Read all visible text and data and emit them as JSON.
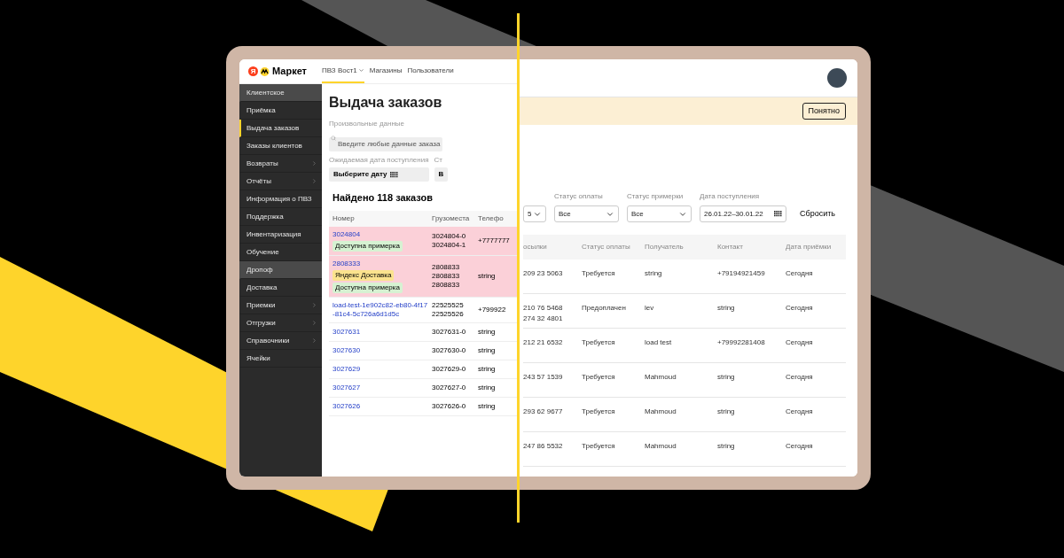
{
  "old_version": {
    "logo": {
      "mark": "Я",
      "text": "Маркет"
    },
    "nav_tabs": [
      {
        "label": "ПВЗ Вост1",
        "selected": true,
        "dropdown": true
      },
      {
        "label": "Магазины",
        "selected": false,
        "dropdown": false
      },
      {
        "label": "Пользователи",
        "selected": false,
        "dropdown": false
      }
    ],
    "sidebar": {
      "items": [
        {
          "label": "Клиентское",
          "selected": false,
          "highlighted": true,
          "expandable": false
        },
        {
          "label": "Приёмка",
          "selected": false,
          "highlighted": false,
          "expandable": false
        },
        {
          "label": "Выдача заказов",
          "selected": true,
          "highlighted": false,
          "expandable": false
        },
        {
          "label": "Заказы клиентов",
          "selected": false,
          "highlighted": false,
          "expandable": false
        },
        {
          "label": "Возвраты",
          "selected": false,
          "highlighted": false,
          "expandable": true
        },
        {
          "label": "Отчёты",
          "selected": false,
          "highlighted": false,
          "expandable": true
        },
        {
          "label": "Информация о ПВЗ",
          "selected": false,
          "highlighted": false,
          "expandable": false
        },
        {
          "label": "Поддержка",
          "selected": false,
          "highlighted": false,
          "expandable": false
        },
        {
          "label": "Инвентаризация",
          "selected": false,
          "highlighted": false,
          "expandable": false
        },
        {
          "label": "Обучение",
          "selected": false,
          "highlighted": false,
          "expandable": false
        },
        {
          "label": "Дропоф",
          "selected": false,
          "highlighted": true,
          "expandable": false
        },
        {
          "label": "Доставка",
          "selected": false,
          "highlighted": false,
          "expandable": false
        },
        {
          "label": "Приемки",
          "selected": false,
          "highlighted": false,
          "expandable": true
        },
        {
          "label": "Отгрузки",
          "selected": false,
          "highlighted": false,
          "expandable": true
        },
        {
          "label": "Справочники",
          "selected": false,
          "highlighted": false,
          "expandable": true
        },
        {
          "label": "Ячейки",
          "selected": false,
          "highlighted": false,
          "expandable": false
        }
      ]
    },
    "title": "Выдача заказов",
    "filters": [
      {
        "kind": "search",
        "label": "Произвольные данные",
        "placeholder": "Введите любые данные заказа"
      },
      {
        "kind": "date",
        "label": "Ожидаемая дата поступления",
        "value": "Выберите дату"
      },
      {
        "kind": "cut",
        "label": "Ст",
        "value": "В"
      }
    ],
    "found": "Найдено 118 заказов",
    "table": {
      "columns": [
        "Номер",
        "Грузоместа",
        "Телефо"
      ],
      "rows": [
        {
          "number": "3024804",
          "highlighted": true,
          "badges": [
            {
              "label": "Доступна примерка",
              "color": "#d6f2d2"
            }
          ],
          "places": [
            "3024804-0",
            "3024804-1"
          ],
          "phone": "+7777777"
        },
        {
          "number": "2808333",
          "highlighted": true,
          "badges": [
            {
              "label": "Яндекс Доставка",
              "color": "#fbe38e"
            },
            {
              "label": "Доступна примерка",
              "color": "#d6f2d2"
            }
          ],
          "places": [
            "2808833",
            "2808833",
            "2808833"
          ],
          "phone": "string"
        },
        {
          "number": "load-test-1e902c82-eb80-4f17-81c4-5c726a6d1d5c",
          "highlighted": false,
          "badges": [],
          "places": [
            "22525525",
            "22525526"
          ],
          "phone": "+799922"
        },
        {
          "number": "3027631",
          "highlighted": false,
          "badges": [],
          "places": [
            "3027631-0"
          ],
          "phone": "string"
        },
        {
          "number": "3027630",
          "highlighted": false,
          "badges": [],
          "places": [
            "3027630-0"
          ],
          "phone": "string"
        },
        {
          "number": "3027629",
          "highlighted": false,
          "badges": [],
          "places": [
            "3027629-0"
          ],
          "phone": "string"
        },
        {
          "number": "3027627",
          "highlighted": false,
          "badges": [],
          "places": [
            "3027627-0"
          ],
          "phone": "string"
        },
        {
          "number": "3027626",
          "highlighted": false,
          "badges": [],
          "places": [
            "3027626-0"
          ],
          "phone": "string"
        }
      ]
    }
  },
  "new_version": {
    "banner": {
      "button": "Понятно"
    },
    "filters": [
      {
        "value": "5",
        "calendar": false
      },
      {
        "label": "Статус оплаты",
        "value": "Все",
        "calendar": false
      },
      {
        "label": "Статус примерки",
        "value": "Все",
        "calendar": false
      },
      {
        "label": "Дата поступления",
        "value": "26.01.22–30.01.22",
        "calendar": true
      }
    ],
    "reset": "Сбросить",
    "table": {
      "columns": [
        "осылки",
        "Статус оплаты",
        "Получатель",
        "Контакт",
        "Дата приёмки"
      ],
      "rows": [
        {
          "cells": [
            [
              "209 23 5063"
            ],
            [
              "Требуется"
            ],
            [
              "string"
            ],
            [
              "+79194921459"
            ],
            [
              "Сегодня"
            ]
          ]
        },
        {
          "cells": [
            [
              "210 76 5468",
              "274 32 4801"
            ],
            [
              "Предоплачен"
            ],
            [
              "lev"
            ],
            [
              "string"
            ],
            [
              "Сегодня"
            ]
          ]
        },
        {
          "cells": [
            [
              "212 21 6532"
            ],
            [
              "Требуется"
            ],
            [
              "load test"
            ],
            [
              "+79992281408"
            ],
            [
              "Сегодня"
            ]
          ]
        },
        {
          "cells": [
            [
              "243 57 1539"
            ],
            [
              "Требуется"
            ],
            [
              "Mahmoud"
            ],
            [
              "string"
            ],
            [
              "Сегодня"
            ]
          ]
        },
        {
          "cells": [
            [
              "293 62 9677"
            ],
            [
              "Требуется"
            ],
            [
              "Mahmoud"
            ],
            [
              "string"
            ],
            [
              "Сегодня"
            ]
          ]
        },
        {
          "cells": [
            [
              "247 86 5532"
            ],
            [
              "Требуется"
            ],
            [
              "Mahmoud"
            ],
            [
              "string"
            ],
            [
              "Сегодня"
            ]
          ]
        }
      ]
    }
  }
}
